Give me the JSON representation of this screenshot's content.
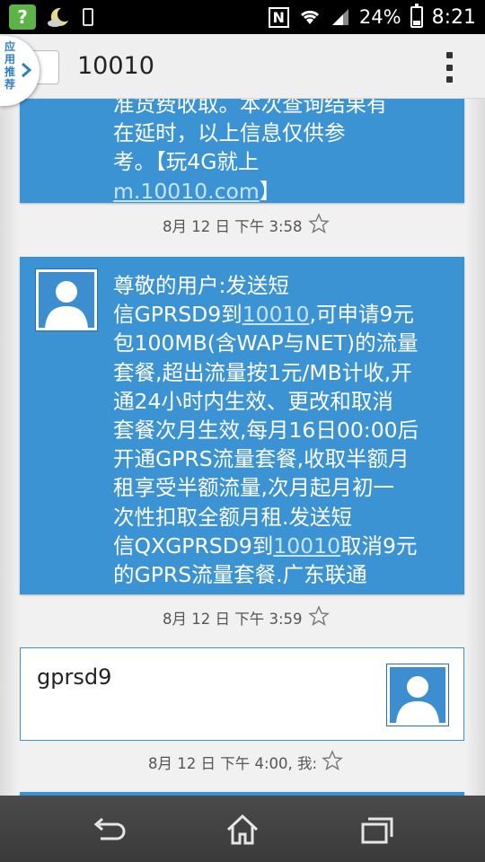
{
  "status_bar": {
    "battery_percent": "24%",
    "time": "8:21",
    "nfc_label": "N",
    "app_icon": "?"
  },
  "side_tab": {
    "label": "应用推荐"
  },
  "action_bar": {
    "title": "10010"
  },
  "messages": [
    {
      "lines": [
        "准货费收取。本次查询结果有",
        "在延时，以上信息仅供参",
        "考。【玩4G就上"
      ],
      "link": "m.10010.com",
      "link_suffix": "】",
      "timestamp": "8月 12 日 下午 3:58"
    },
    {
      "lines": [
        "尊敬的用户:发送短",
        "信GPRSD9到",
        "包100MB(含WAP与NET)的流量",
        "套餐,超出流量按1元/MB计收,开",
        "通24小时内生效、更改和取消",
        "套餐次月生效,每月16日00:00后",
        "开通GPRS流量套餐,收取半额月",
        "租享受半额流量,次月起月初一",
        "次性扣取全额月租.发送短",
        "信QXGPRSD9到",
        "的GPRS流量套餐.广东联通"
      ],
      "link_1": "10010",
      "after_link_1": ",可申请9元",
      "link_2": "10010",
      "after_link_2": "取消9元",
      "timestamp": "8月 12 日 下午 3:59"
    },
    {
      "text": "gprsd9",
      "timestamp": "8月 12 日 下午 4:00, 我:"
    }
  ],
  "icons": {
    "back": "back-icon",
    "home": "home-icon",
    "recents": "recent-apps-icon",
    "overflow": "overflow-menu-icon",
    "star": "star-outline-icon"
  },
  "colors": {
    "bubble_blue": "#3c93d3",
    "link_blue": "#c7e4ff",
    "background": "#f1f1f1"
  }
}
